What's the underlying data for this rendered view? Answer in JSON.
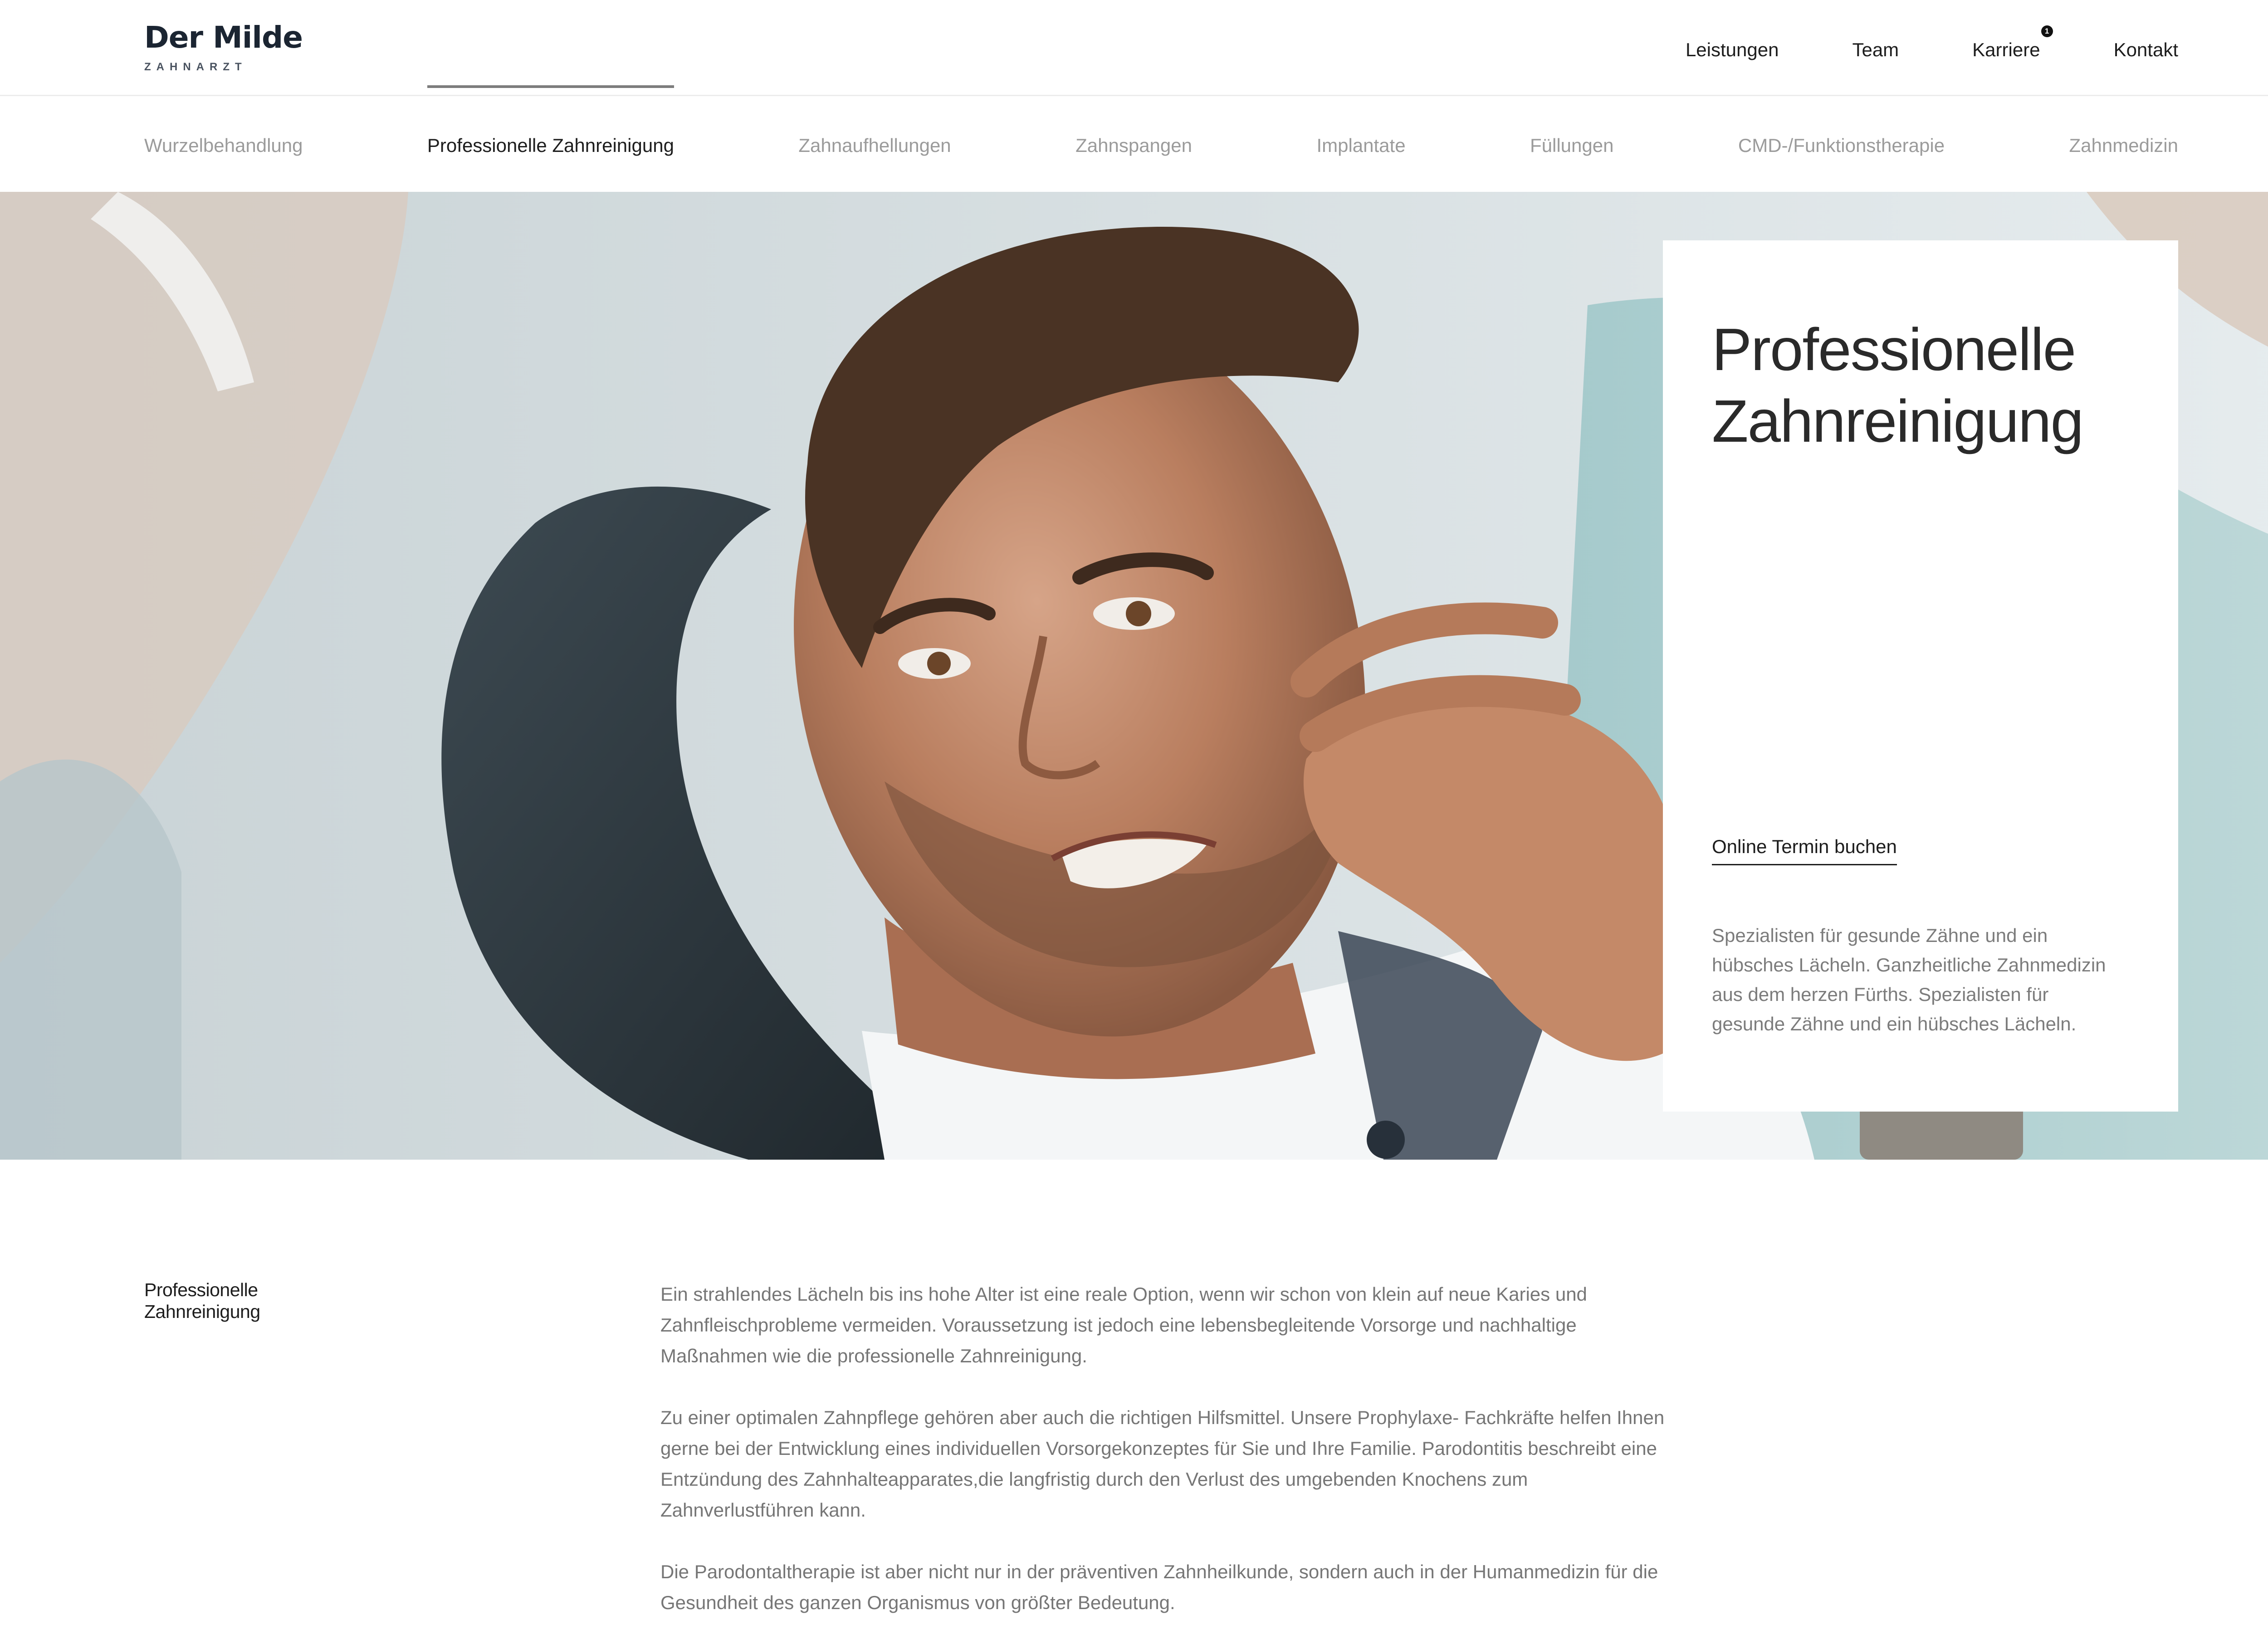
{
  "brand": {
    "name": "Der Milde",
    "subtitle": "ZAHNARZT"
  },
  "topnav": {
    "items": [
      {
        "label": "Leistungen"
      },
      {
        "label": "Team"
      },
      {
        "label": "Karriere",
        "badge": "1"
      },
      {
        "label": "Kontakt"
      }
    ]
  },
  "subnav": {
    "items": [
      {
        "label": "Wurzelbehandlung",
        "active": false
      },
      {
        "label": "Professionelle Zahnreinigung",
        "active": true
      },
      {
        "label": "Zahnaufhellungen",
        "active": false
      },
      {
        "label": "Zahnspangen",
        "active": false
      },
      {
        "label": "Implantate",
        "active": false
      },
      {
        "label": "Füllungen",
        "active": false
      },
      {
        "label": "CMD-/Funktionstherapie",
        "active": false
      },
      {
        "label": "Zahnmedizin",
        "active": false
      }
    ]
  },
  "hero": {
    "title_line1": "Professionelle",
    "title_line2": "Zahnreinigung",
    "cta": "Online Termin buchen",
    "description": "Spezialisten für gesunde Zähne und ein hübsches Lächeln. Ganzheitliche Zahnmedizin aus dem herzen Fürths. Spezialisten für gesunde Zähne und ein hübsches Lächeln."
  },
  "content": {
    "label_line1": "Professionelle",
    "label_line2": "Zahnreinigung",
    "paragraphs": [
      "Ein strahlendes Lächeln bis ins hohe Alter ist eine reale Option, wenn wir schon von klein auf neue Karies und Zahnfleischprobleme vermeiden. Voraussetzung ist jedoch eine lebensbegleitende Vorsorge und nachhaltige Maßnahmen wie die professionelle Zahnreinigung.",
      "Zu einer optimalen Zahnpflege gehören aber auch die richtigen Hilfsmittel. Unsere Prophylaxe- Fachkräfte helfen Ihnen gerne bei der Entwicklung eines individuellen Vorsorgekonzeptes für Sie und Ihre Familie. Parodontitis beschreibt eine Entzündung des Zahnhalteapparates,die langfristig durch den Verlust des umgebenden Knochens zum Zahnverlustführen kann.",
      "Die Parodontaltherapie ist aber nicht nur in der präventiven Zahnheilkunde, sondern auch in der Humanmedizin für die Gesundheit des ganzen Organismus von größter Bedeutung."
    ]
  },
  "colors": {
    "brand_dark": "#1b2532",
    "text_dark": "#1d1d1d",
    "text_muted": "#767676",
    "nav_inactive": "#9b9b9b"
  }
}
